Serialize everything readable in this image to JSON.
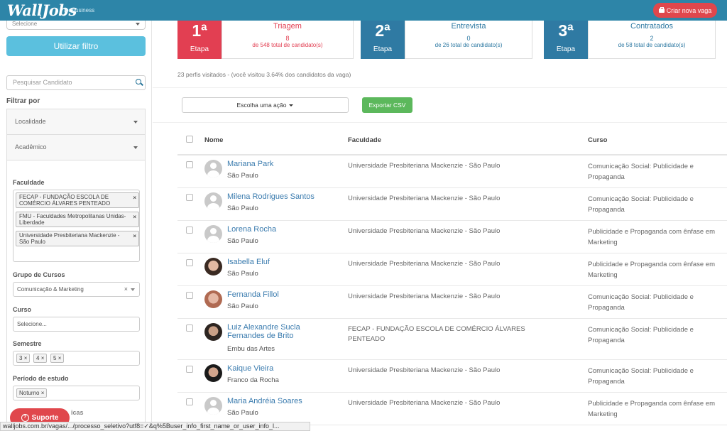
{
  "header": {
    "logo": "WallJobs",
    "logo_sub": "for business",
    "create_button": "Criar nova vaga"
  },
  "sidebar": {
    "select_top": "Selecione",
    "filter_button": "Utilizar filtro",
    "search_placeholder": "Pesquisar Candidato",
    "filter_by": "Filtrar por",
    "accordion_location": "Localidade",
    "accordion_academic": "Acadêmico",
    "faculdade_label": "Faculdade",
    "faculdade_chips": [
      "FECAP - FUNDAÇÃO ESCOLA DE COMÉRCIO ÁLVARES PENTEADO",
      "FMU - Faculdades Metropolitanas Unidas- Liberdade",
      "Universidade Presbiteriana Mackenzie - São Paulo"
    ],
    "grupo_label": "Grupo de Cursos",
    "grupo_value": "Comunicação & Marketing",
    "curso_label": "Curso",
    "curso_placeholder": "Selecione...",
    "semestre_label": "Semestre",
    "semestre_chips": [
      "3",
      "4",
      "5"
    ],
    "periodo_label": "Período de estudo",
    "periodo_chips": [
      "Noturno"
    ],
    "hidden_label": "icas",
    "support_button": "Suporte"
  },
  "stages": [
    {
      "num": "1ª",
      "etapa": "Etapa",
      "title": "Triagem",
      "count": "8",
      "total": "de 548 total de candidato(s)",
      "color": "#e23f52",
      "text_color": "#e23f52"
    },
    {
      "num": "2ª",
      "etapa": "Etapa",
      "title": "Entrevista",
      "count": "0",
      "total": "de 26 total de candidato(s)",
      "color": "#2f7aa3",
      "text_color": "#2f7aa3"
    },
    {
      "num": "3ª",
      "etapa": "Etapa",
      "title": "Contratados",
      "count": "2",
      "total": "de 58 total de candidato(s)",
      "color": "#2f7aa3",
      "text_color": "#2f7aa3"
    }
  ],
  "visits_text": "23 perfis visitados - (você visitou 3.64% dos candidatos da vaga)",
  "actions": {
    "select_label": "Escolha uma ação",
    "export_button": "Exportar CSV"
  },
  "table": {
    "headers": {
      "nome": "Nome",
      "faculdade": "Faculdade",
      "curso": "Curso"
    },
    "rows": [
      {
        "name": "Mariana Park",
        "city": "São Paulo",
        "faculdade": "Universidade Presbiteriana Mackenzie - São Paulo",
        "curso": "Comunicação Social: Publicidade e Propaganda",
        "avatar": "placeholder"
      },
      {
        "name": "Milena Rodrigues Santos",
        "city": "São Paulo",
        "faculdade": "Universidade Presbiteriana Mackenzie - São Paulo",
        "curso": "Comunicação Social: Publicidade e Propaganda",
        "avatar": "placeholder"
      },
      {
        "name": "Lorena Rocha",
        "city": "São Paulo",
        "faculdade": "Universidade Presbiteriana Mackenzie - São Paulo",
        "curso": "Publicidade e Propaganda com ênfase em Marketing",
        "avatar": "placeholder"
      },
      {
        "name": "Isabella Eluf",
        "city": "São Paulo",
        "faculdade": "Universidade Presbiteriana Mackenzie - São Paulo",
        "curso": "Publicidade e Propaganda com ênfase em Marketing",
        "avatar": "photo1"
      },
      {
        "name": "Fernanda Fillol",
        "city": "São Paulo",
        "faculdade": "Universidade Presbiteriana Mackenzie - São Paulo",
        "curso": "Comunicação Social: Publicidade e Propaganda",
        "avatar": "photo2"
      },
      {
        "name": "Luiz Alexandre Sucla Fernandes de Brito",
        "city": "Embu das Artes",
        "faculdade": "FECAP - FUNDAÇÃO ESCOLA DE COMÉRCIO ÁLVARES PENTEADO",
        "curso": "Comunicação Social: Publicidade e Propaganda",
        "avatar": "photo3"
      },
      {
        "name": "Kaique Vieira",
        "city": "Franco da Rocha",
        "faculdade": "Universidade Presbiteriana Mackenzie - São Paulo",
        "curso": "Comunicação Social: Publicidade e Propaganda",
        "avatar": "photo4"
      },
      {
        "name": "Maria Andréia Soares",
        "city": "São Paulo",
        "faculdade": "Universidade Presbiteriana Mackenzie - São Paulo",
        "curso": "Publicidade e Propaganda com ênfase em Marketing",
        "avatar": "placeholder"
      }
    ]
  },
  "statusbar": "walljobs.com.br/vagas/.../processo_seletivo?utf8=✓&q%5Buser_info_first_name_or_user_info_l..."
}
